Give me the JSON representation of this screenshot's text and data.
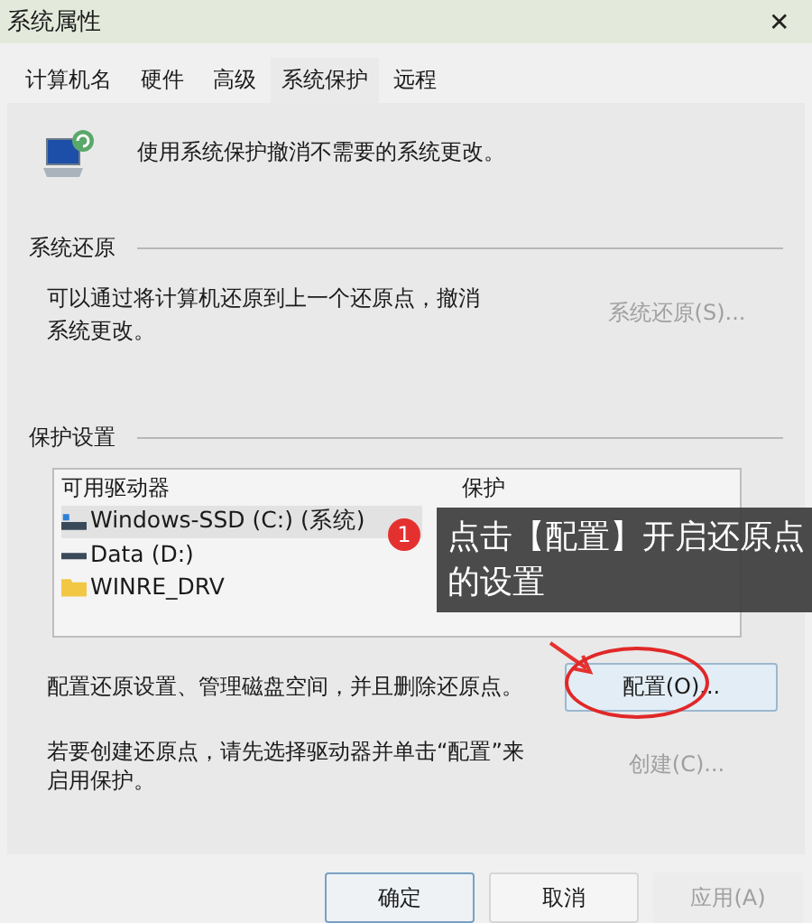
{
  "window": {
    "title": "系统属性",
    "close": "✕"
  },
  "tabs": [
    {
      "label": "计算机名",
      "selected": false
    },
    {
      "label": "硬件",
      "selected": false
    },
    {
      "label": "高级",
      "selected": false
    },
    {
      "label": "系统保护",
      "selected": true
    },
    {
      "label": "远程",
      "selected": false
    }
  ],
  "intro": "使用系统保护撤消不需要的系统更改。",
  "restore": {
    "heading": "系统还原",
    "text": "可以通过将计算机还原到上一个还原点，撤消系统更改。",
    "button": {
      "label": "系统还原(S)...",
      "disabled": true
    }
  },
  "protection": {
    "heading": "保护设置",
    "columns": [
      "可用驱动器",
      "保护"
    ],
    "drives": [
      {
        "kind": "system",
        "name": "Windows-SSD (C:) (系统)",
        "selected": true
      },
      {
        "kind": "disk",
        "name": "Data (D:)",
        "selected": false
      },
      {
        "kind": "folder",
        "name": "WINRE_DRV",
        "selected": false
      }
    ],
    "configure_text": "配置还原设置、管理磁盘空间，并且删除还原点。",
    "configure_button": {
      "label": "配置(O)...",
      "disabled": false
    },
    "create_text": "若要创建还原点，请先选择驱动器并单击“配置”来启用保护。",
    "create_button": {
      "label": "创建(C)...",
      "disabled": true
    }
  },
  "buttons": [
    {
      "label": "确定",
      "disabled": false
    },
    {
      "label": "取消",
      "disabled": false
    },
    {
      "label": "应用(A)",
      "disabled": true
    }
  ],
  "annotation": {
    "step": "1",
    "text": "点击【配置】开启还原点的设置"
  }
}
